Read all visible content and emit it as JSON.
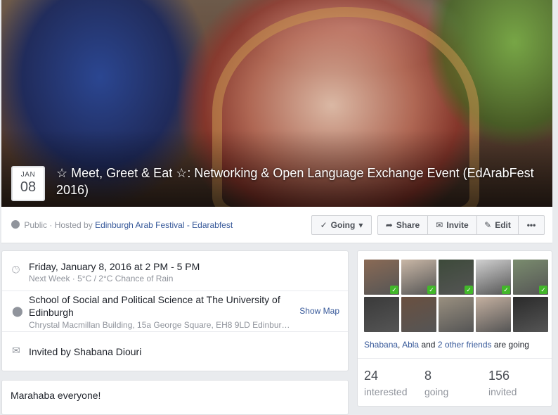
{
  "cover": {
    "date_month": "JAN",
    "date_day": "08",
    "title": "☆ Meet, Greet & Eat ☆: Networking & Open Language Exchange Event (EdArabFest 2016)"
  },
  "action_bar": {
    "privacy": "Public",
    "hosted_prefix": "· Hosted by",
    "host_name": "Edinburgh Arab Festival - Edarabfest",
    "going_label": "Going",
    "share_label": "Share",
    "invite_label": "Invite",
    "edit_label": "Edit",
    "more_label": "•••"
  },
  "details": {
    "datetime": "Friday, January 8, 2016 at 2 PM - 5 PM",
    "weather": "Next Week · 5°C / 2°C Chance of Rain",
    "venue_line1": "School of Social and Political Science at The University of",
    "venue_line2": "Edinburgh",
    "address": "Chrystal Macmillan Building, 15a George Square, EH8 9LD Edinbur…",
    "show_map": "Show Map",
    "invited_by": "Invited by Shabana Diouri"
  },
  "description": {
    "first_line": "Marahaba everyone!"
  },
  "friends": {
    "avatars": [
      {
        "color": "#8a6a55",
        "checked": true
      },
      {
        "color": "#c9b7a6",
        "checked": true
      },
      {
        "color": "#3d4a3a",
        "checked": true
      },
      {
        "color": "#d0d0d0",
        "checked": true
      },
      {
        "color": "#7a8c6e",
        "checked": true
      },
      {
        "color": "#3a3a3a",
        "checked": false
      },
      {
        "color": "#6a5040",
        "checked": false
      },
      {
        "color": "#9a9080",
        "checked": false
      },
      {
        "color": "#c4b0a0",
        "checked": false
      },
      {
        "color": "#2a2a2a",
        "checked": false
      }
    ],
    "name1": "Shabana",
    "sep1": ",",
    "name2": "Abla",
    "and_word": "and",
    "others": "2 other friends",
    "going_suffix": "are going",
    "stats": [
      {
        "num": "24",
        "label": "interested"
      },
      {
        "num": "8",
        "label": "going"
      },
      {
        "num": "156",
        "label": "invited"
      }
    ]
  }
}
